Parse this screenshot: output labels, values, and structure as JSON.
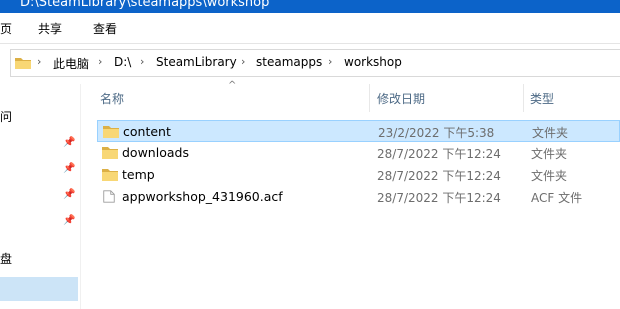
{
  "window": {
    "title": "D:\\SteamLibrary\\steamapps\\workshop"
  },
  "ribbon": {
    "tabs": [
      "页",
      "共享",
      "查看"
    ]
  },
  "address": {
    "crumbs": [
      "此电脑",
      "D:\\",
      "SteamLibrary",
      "steamapps",
      "workshop"
    ]
  },
  "nav": {
    "items": [
      "问",
      "盘"
    ]
  },
  "columns": {
    "name": "名称",
    "modified": "修改日期",
    "type": "类型"
  },
  "files": [
    {
      "name": "content",
      "modified": "23/2/2022 下午5:38",
      "type": "文件夹",
      "kind": "folder",
      "selected": true
    },
    {
      "name": "downloads",
      "modified": "28/7/2022 下午12:24",
      "type": "文件夹",
      "kind": "folder",
      "selected": false
    },
    {
      "name": "temp",
      "modified": "28/7/2022 下午12:24",
      "type": "文件夹",
      "kind": "folder",
      "selected": false
    },
    {
      "name": "appworkshop_431960.acf",
      "modified": "28/7/2022 下午12:24",
      "type": "ACF 文件",
      "kind": "file",
      "selected": false
    }
  ],
  "colors": {
    "titlebar": "#0c63c9",
    "selection": "#cce8ff",
    "folder": "#f8d775"
  }
}
